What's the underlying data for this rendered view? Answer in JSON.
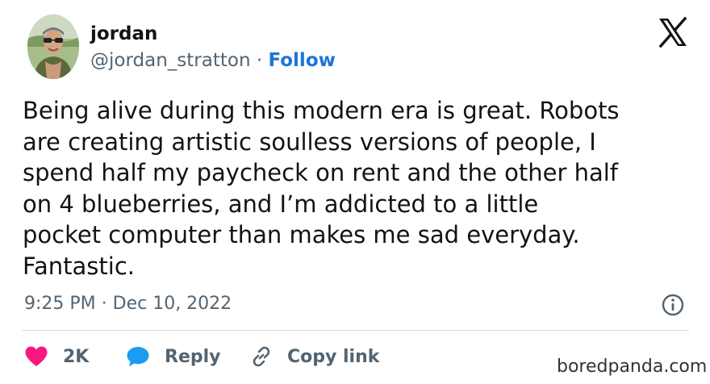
{
  "user": {
    "name": "jordan",
    "handle": "@jordan_stratton",
    "separator": " · ",
    "follow_label": "Follow"
  },
  "tweet": {
    "text": "Being alive during this modern era is great. Robots\nare creating artistic soulless versions of people, I\nspend half my paycheck on rent and the other half\non 4 blueberries, and I’m addicted to a little\npocket computer than makes me sad everyday.\nFantastic.",
    "time": "9:25 PM",
    "date_separator": " · ",
    "date": "Dec 10, 2022"
  },
  "actions": {
    "like_count": "2K",
    "reply_label": "Reply",
    "copy_link_label": "Copy link"
  },
  "watermark": "boredpanda.com",
  "icons": {
    "platform_logo": "x-logo-icon",
    "info": "info-icon",
    "like": "heart-icon",
    "reply": "speech-bubble-icon",
    "copy_link": "link-icon"
  },
  "colors": {
    "text": "#0f1419",
    "secondary": "#536471",
    "follow": "#1d75d8",
    "heart": "#f91880",
    "reply": "#1d9bf0",
    "divider": "#cfd9de"
  }
}
